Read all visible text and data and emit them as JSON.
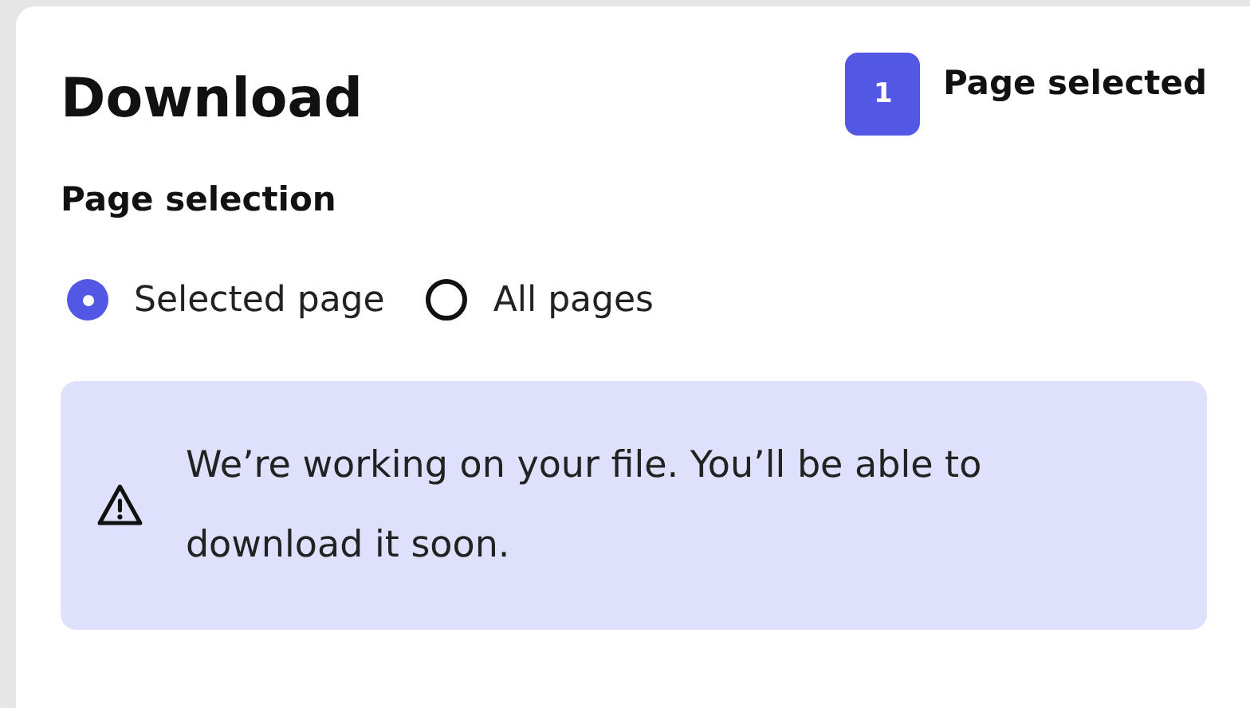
{
  "dialog": {
    "title": "Download",
    "badge": {
      "count": "1",
      "label": "Page selected"
    }
  },
  "page_selection": {
    "heading": "Page selection",
    "options": [
      {
        "label": "Selected page",
        "selected": true
      },
      {
        "label": "All pages",
        "selected": false
      }
    ]
  },
  "alert": {
    "kind": "warning",
    "message": "We’re working on your file. You’ll be able to download it soon."
  }
}
